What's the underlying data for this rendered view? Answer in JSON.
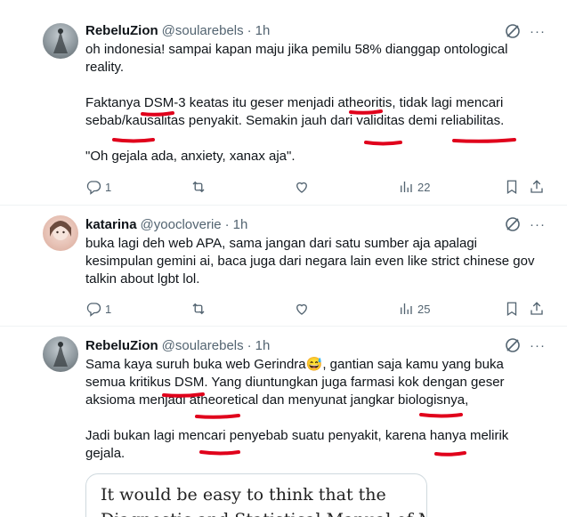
{
  "tweets": [
    {
      "display_name": "RebeluZion",
      "handle": "@soularebels",
      "separator": "·",
      "time": "1h",
      "more": "···",
      "paragraphs": [
        "oh indonesia! sampai kapan maju jika pemilu 58% dianggap ontological",
        "reality.",
        "Faktanya DSM-3 keatas itu geser menjadi atheoritis, tidak lagi mencari",
        "sebab/kausalitas penyakit. Semakin jauh dari validitas demi reliabilitas.",
        "\"Oh gejala ada, anxiety, xanax aja\"."
      ],
      "replies": "1",
      "reposts": "",
      "likes": "",
      "views": "22"
    },
    {
      "display_name": "katarina",
      "handle": "@yoocloverie",
      "separator": "·",
      "time": "1h",
      "more": "···",
      "paragraphs": [
        "buka lagi deh web APA, sama jangan dari satu sumber aja apalagi",
        "kesimpulan gemini ai, baca juga dari negara lain even like strict chinese gov",
        "talkin about lgbt lol."
      ],
      "replies": "1",
      "reposts": "",
      "likes": "",
      "views": "25"
    },
    {
      "display_name": "RebeluZion",
      "handle": "@soularebels",
      "separator": "·",
      "time": "1h",
      "more": "···",
      "paragraphs": [
        "Sama kaya suruh buka web Gerindra",
        "semua kritikus DSM. Yang diuntungkan juga farmasi kok dengan geser",
        "aksioma menjadi atheoretical dan menyunat jangkar biologisnya,",
        "Jadi bukan lagi mencari penyebab suatu penyakit, karena hanya melirik",
        "gejala."
      ],
      "line1_suffix": ",  gantian saja kamu yang buka",
      "emoji": "😅",
      "quote_line1": "It would be easy to think that the",
      "quote_line2": "Diagnostic and Statistical Manual of Mental"
    }
  ],
  "colors": {
    "text": "#0f1419",
    "secondary": "#536471",
    "divider": "#eff3f4",
    "annotation": "#e0001b"
  },
  "icons": [
    "reply-icon",
    "repost-icon",
    "like-icon",
    "views-icon",
    "bookmark-icon",
    "share-icon",
    "grok-icon",
    "more-icon"
  ]
}
